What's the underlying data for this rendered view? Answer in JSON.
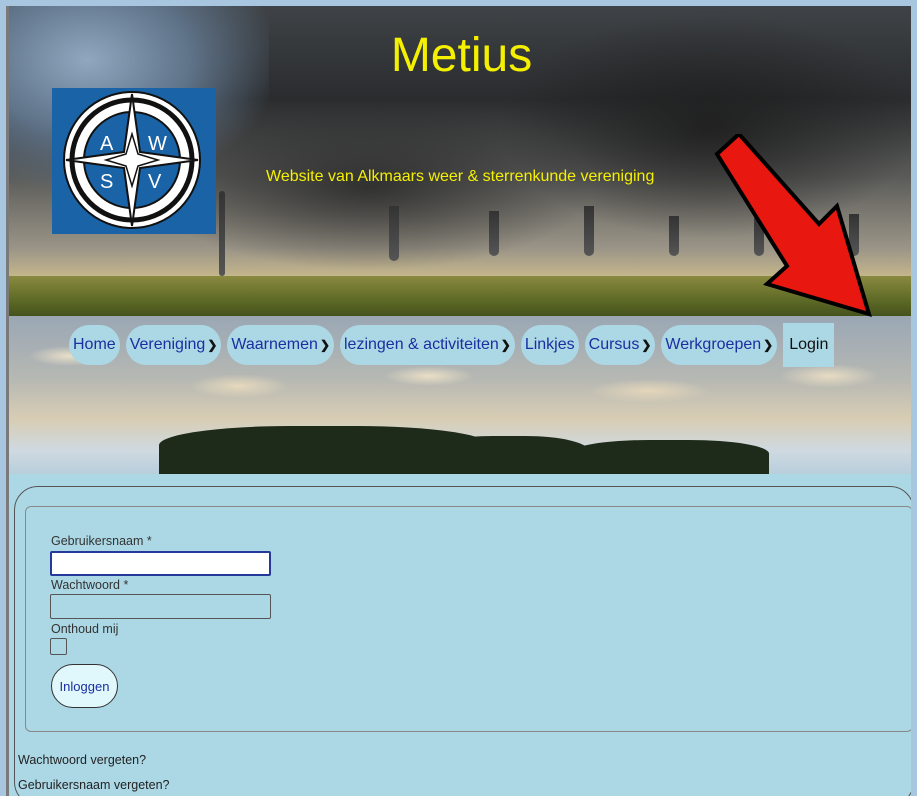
{
  "header": {
    "title": "Metius",
    "tagline": "Website van Alkmaars weer & sterrenkunde vereniging",
    "logo_letters": [
      "A",
      "W",
      "S",
      "V"
    ]
  },
  "nav": {
    "items": [
      {
        "label": "Home",
        "has_dropdown": false
      },
      {
        "label": "Vereniging",
        "has_dropdown": true
      },
      {
        "label": "Waarnemen",
        "has_dropdown": true
      },
      {
        "label": "lezingen & activiteiten",
        "has_dropdown": true
      },
      {
        "label": "Linkjes",
        "has_dropdown": false
      },
      {
        "label": "Cursus",
        "has_dropdown": true
      },
      {
        "label": "Werkgroepen",
        "has_dropdown": true
      },
      {
        "label": "Login",
        "has_dropdown": false
      }
    ]
  },
  "login_form": {
    "username_label": "Gebruikersnaam *",
    "username_value": "",
    "password_label": "Wachtwoord *",
    "password_value": "",
    "remember_label": "Onthoud mij",
    "remember_checked": false,
    "submit_label": "Inloggen",
    "forgot_password": "Wachtwoord vergeten?",
    "forgot_username": "Gebruikersnaam vergeten?"
  },
  "colors": {
    "title": "#f5f000",
    "nav_pill": "#acd8e6",
    "nav_text": "#1a2fa0",
    "page_bg": "#acd8e6",
    "arrow": "#e8170f"
  }
}
